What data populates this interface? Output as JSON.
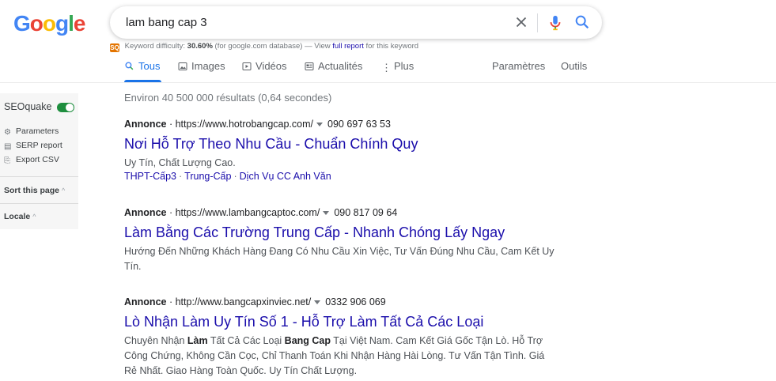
{
  "logo": {
    "letters": [
      "G",
      "o",
      "o",
      "g",
      "l",
      "e"
    ],
    "colors": [
      "#4285f4",
      "#ea4335",
      "#fbbc05",
      "#4285f4",
      "#34a853",
      "#ea4335"
    ]
  },
  "search": {
    "query": "lam bang cap 3"
  },
  "seo_difficulty": {
    "badge": "SQ",
    "label": "Keyword difficulty:",
    "value": "30.60%",
    "scope": "(for google.com database) — View",
    "link": "full report",
    "suffix": "for this keyword"
  },
  "tabs": [
    {
      "label": "Tous",
      "icon": "search-icon",
      "active": true
    },
    {
      "label": "Images",
      "icon": "image-icon"
    },
    {
      "label": "Vidéos",
      "icon": "video-icon"
    },
    {
      "label": "Actualités",
      "icon": "news-icon"
    },
    {
      "label": "Plus",
      "icon": "more-vert-icon"
    }
  ],
  "tools": {
    "settings": "Paramètres",
    "tools": "Outils"
  },
  "sidebar": {
    "title": "SEOquake",
    "toggle_on": true,
    "items": [
      "Parameters",
      "SERP report",
      "Export CSV"
    ],
    "sort_label": "Sort this page",
    "locale_label": "Locale"
  },
  "stats": "Environ 40 500 000 résultats (0,64 secondes)",
  "ads": [
    {
      "badge": "Annonce",
      "url": "https://www.hotrobangcap.com/",
      "phone": "090 697 63 53",
      "title": "Nơi Hỗ Trợ Theo Nhu Cầu - Chuẩn Chính Quy",
      "desc": "Uy Tín, Chất Lượng Cao.",
      "sitelinks": [
        "THPT-Cấp3",
        "Trung-Cấp",
        "Dịch Vụ CC Anh Văn"
      ]
    },
    {
      "badge": "Annonce",
      "url": "https://www.lambangcaptoc.com/",
      "phone": "090 817 09 64",
      "title": "Làm Bằng Các Trường Trung Cấp - Nhanh Chóng Lấy Ngay",
      "desc": "Hướng Đến Những Khách Hàng Đang Có Nhu Cầu Xin Việc, Tư Vấn Đúng Nhu Cầu, Cam Kết Uy Tín."
    },
    {
      "badge": "Annonce",
      "url": "http://www.bangcapxinviec.net/",
      "phone": "0332 906 069",
      "title": "Lò Nhận Làm Uy Tín Số 1 - Hỗ Trợ Làm Tất Cả Các Loại",
      "desc_parts": [
        "Chuyên Nhận ",
        "Làm",
        " Tất Cả Các Loại ",
        "Bang Cap",
        " Tại Việt Nam. Cam Kết Giá Gốc Tận Lò. Hỗ Trợ Công Chứng, Không Cần Cọc, Chỉ Thanh Toán Khi Nhận Hàng Hài Lòng. Tư Vấn Tận Tình. Giá Rẻ Nhất. Giao Hàng Toàn Quốc. Uy Tín Chất Lượng."
      ]
    }
  ]
}
